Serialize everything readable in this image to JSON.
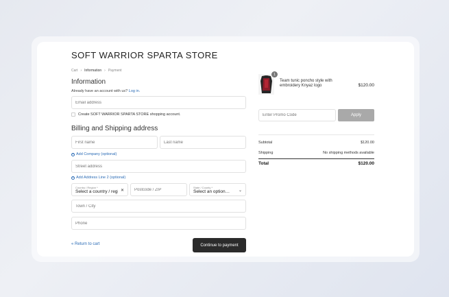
{
  "store": {
    "title": "SOFT WARRIOR SPARTA STORE"
  },
  "breadcrumb": {
    "cart": "Cart",
    "information": "Information",
    "payment": "Payment"
  },
  "information": {
    "heading": "Information",
    "account_prompt": "Already have an account with us?",
    "login_link": "Log in.",
    "email_placeholder": "Email address",
    "create_account_label": "Create SOFT WARRIOR SPARTA STORE shopping account."
  },
  "billing": {
    "heading": "Billing and Shipping address",
    "first_name_placeholder": "First name",
    "last_name_placeholder": "Last name",
    "add_company": "Add Company (optional)",
    "street_placeholder": "Street address",
    "add_address_line2": "Add Address Line 2 (optional)",
    "country_label": "Country / Region *",
    "country_value": "Select a country / region…",
    "postcode_placeholder": "Postcode / ZIP",
    "state_label": "State / County *",
    "state_value": "Select an option…",
    "city_placeholder": "Town / City",
    "phone_placeholder": "Phone"
  },
  "actions": {
    "back": "« Return to cart",
    "continue": "Continue to payment"
  },
  "cart": {
    "quantity": "1",
    "product_name": "Team tunic poncho style with embroidery Knyaz logo",
    "product_price": "$120.00",
    "promo_placeholder": "Enter Promo Code",
    "apply_label": "Apply"
  },
  "summary": {
    "subtotal_label": "Subtotal",
    "subtotal_value": "$120.00",
    "shipping_label": "Shipping",
    "shipping_value": "No shipping methods available",
    "total_label": "Total",
    "total_value": "$120.00"
  },
  "colors": {
    "link": "#2a6bb5",
    "primary_button": "#2b2b2b",
    "apply_button": "#a9a9a9"
  }
}
